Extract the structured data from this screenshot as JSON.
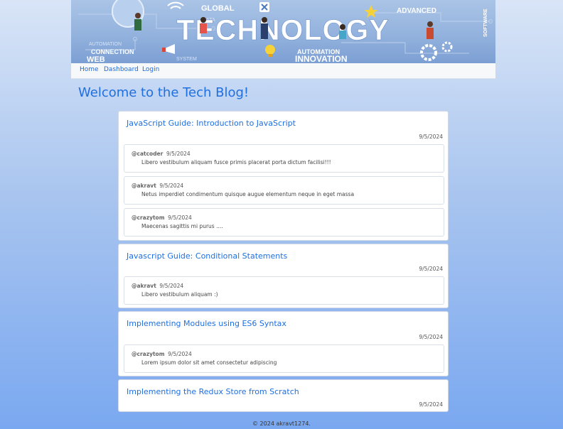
{
  "banner": {
    "title": "TECHNOLOGY",
    "words": {
      "global": "GLOBAL",
      "advanced": "ADVANCED",
      "software": "SOFTWARE",
      "connection": "CONNECTION",
      "web": "WEB",
      "automation_top": "AUTOMATION",
      "automation": "AUTOMATION",
      "innovation": "INNOVATION",
      "data": "DATA",
      "system": "SYSTEM"
    }
  },
  "nav": {
    "home": "Home",
    "dashboard": "Dashboard",
    "login": "Login"
  },
  "page_title": "Welcome to the Tech Blog!",
  "posts": [
    {
      "title": "JavaScript Guide: Introduction to JavaScript",
      "date": "9/5/2024",
      "comments": [
        {
          "author": "@catcoder",
          "date": "9/5/2024",
          "text": "Libero vestibulum aliquam fusce primis placerat porta dictum facilisi!!!"
        },
        {
          "author": "@akravt",
          "date": "9/5/2024",
          "text": "Netus imperdiet condimentum quisque augue elementum neque in eget massa"
        },
        {
          "author": "@crazytom",
          "date": "9/5/2024",
          "text": "Maecenas sagittis mi purus ...."
        }
      ]
    },
    {
      "title": "Javascript Guide: Conditional Statements",
      "date": "9/5/2024",
      "comments": [
        {
          "author": "@akravt",
          "date": "9/5/2024",
          "text": "Libero vestibulum aliquam :)"
        }
      ]
    },
    {
      "title": "Implementing Modules using ES6 Syntax",
      "date": "9/5/2024",
      "comments": [
        {
          "author": "@crazytom",
          "date": "9/5/2024",
          "text": "Lorem ipsum dolor sit amet consectetur adipiscing"
        }
      ]
    },
    {
      "title": "Implementing the Redux Store from Scratch",
      "date": "9/5/2024",
      "comments": []
    }
  ],
  "footer": "© 2024 akravt1274."
}
